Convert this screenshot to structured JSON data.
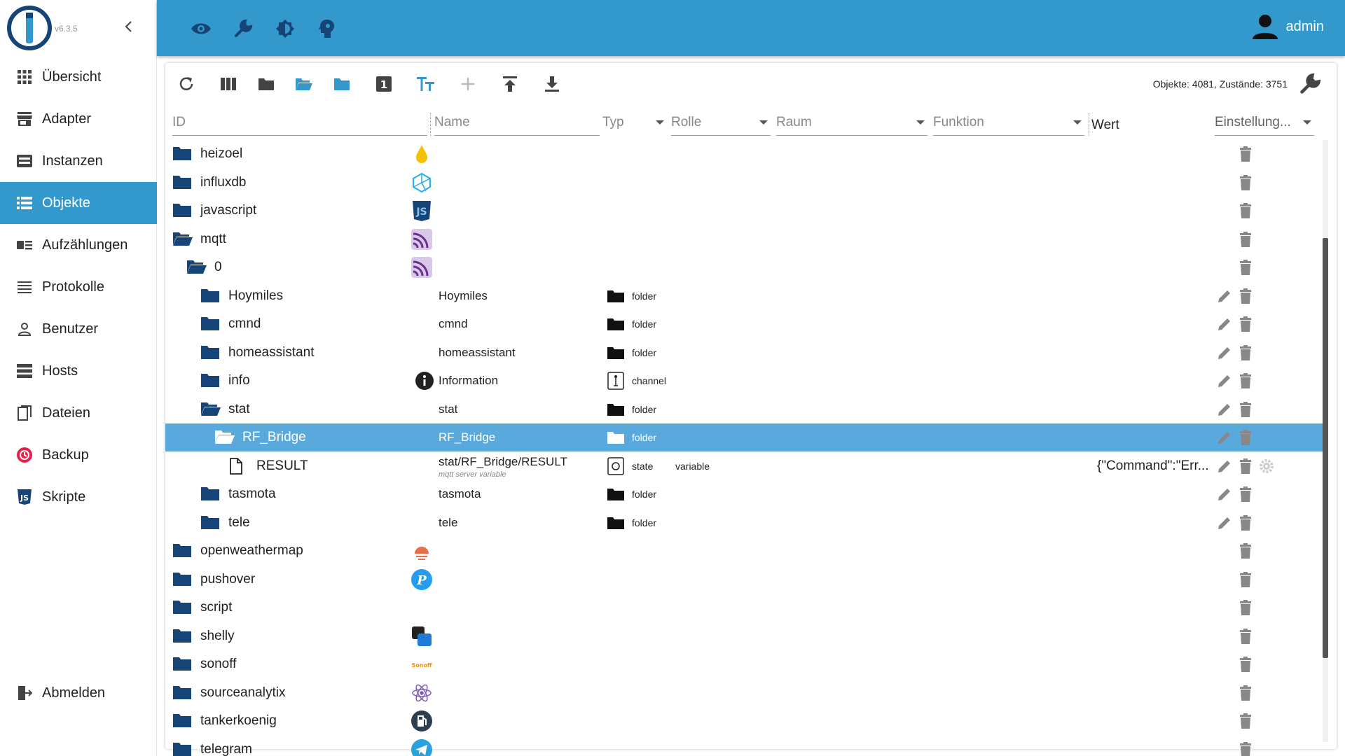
{
  "sidebar": {
    "version": "v6.3.5",
    "items": [
      {
        "label": "Übersicht",
        "icon": "grid-icon"
      },
      {
        "label": "Adapter",
        "icon": "store-icon"
      },
      {
        "label": "Instanzen",
        "icon": "instances-icon"
      },
      {
        "label": "Objekte",
        "icon": "list-icon",
        "active": true
      },
      {
        "label": "Aufzählungen",
        "icon": "enum-icon"
      },
      {
        "label": "Protokolle",
        "icon": "lines-icon"
      },
      {
        "label": "Benutzer",
        "icon": "person-icon"
      },
      {
        "label": "Hosts",
        "icon": "hosts-icon"
      },
      {
        "label": "Dateien",
        "icon": "files-icon"
      },
      {
        "label": "Backup",
        "icon": "backup-icon"
      },
      {
        "label": "Skripte",
        "icon": "js-icon"
      }
    ],
    "logout": "Abmelden"
  },
  "header": {
    "user": "admin",
    "icons": [
      "eye-icon",
      "wrench-icon",
      "brightness-icon",
      "head-icon"
    ]
  },
  "toolbar": {
    "stats": "Objekte: 4081, Zustände: 3751"
  },
  "columns": {
    "id": "ID",
    "name": "Name",
    "type": "Typ",
    "role": "Rolle",
    "room": "Raum",
    "function": "Funktion",
    "value": "Wert",
    "settings": "Einstellung..."
  },
  "rows": [
    {
      "id": "heizoel",
      "depth": 0,
      "folder": "closed",
      "adapter_icon": "drop-icon"
    },
    {
      "id": "influxdb",
      "depth": 0,
      "folder": "closed",
      "adapter_icon": "influx-icon"
    },
    {
      "id": "javascript",
      "depth": 0,
      "folder": "closed",
      "adapter_icon": "js-icon"
    },
    {
      "id": "mqtt",
      "depth": 0,
      "folder": "open",
      "adapter_icon": "mqtt-icon"
    },
    {
      "id": "0",
      "depth": 1,
      "folder": "open",
      "adapter_icon": "mqtt-icon"
    },
    {
      "id": "Hoymiles",
      "depth": 2,
      "folder": "closed",
      "name": "Hoymiles",
      "type": "folder",
      "editable": true
    },
    {
      "id": "cmnd",
      "depth": 2,
      "folder": "closed",
      "name": "cmnd",
      "type": "folder",
      "editable": true
    },
    {
      "id": "homeassistant",
      "depth": 2,
      "folder": "closed",
      "name": "homeassistant",
      "type": "folder",
      "editable": true
    },
    {
      "id": "info",
      "depth": 2,
      "folder": "closed",
      "name": "Information",
      "type": "channel",
      "name_icon": "info-icon",
      "editable": true
    },
    {
      "id": "stat",
      "depth": 2,
      "folder": "open",
      "name": "stat",
      "type": "folder",
      "editable": true
    },
    {
      "id": "RF_Bridge",
      "depth": 3,
      "folder": "open",
      "name": "RF_Bridge",
      "type": "folder",
      "editable": true,
      "selected": true
    },
    {
      "id": "RESULT",
      "depth": 4,
      "folder": "file",
      "name": "stat/RF_Bridge/RESULT",
      "subname": "mqtt server variable",
      "type": "state",
      "role": "variable",
      "value": "{\"Command\":\"Err...",
      "editable": true,
      "gear": true
    },
    {
      "id": "tasmota",
      "depth": 2,
      "folder": "closed",
      "name": "tasmota",
      "type": "folder",
      "editable": true
    },
    {
      "id": "tele",
      "depth": 2,
      "folder": "closed",
      "name": "tele",
      "type": "folder",
      "editable": true
    },
    {
      "id": "openweathermap",
      "depth": 0,
      "folder": "closed",
      "adapter_icon": "weather-icon"
    },
    {
      "id": "pushover",
      "depth": 0,
      "folder": "closed",
      "adapter_icon": "pushover-icon"
    },
    {
      "id": "script",
      "depth": 0,
      "folder": "closed"
    },
    {
      "id": "shelly",
      "depth": 0,
      "folder": "closed",
      "adapter_icon": "shelly-icon"
    },
    {
      "id": "sonoff",
      "depth": 0,
      "folder": "closed",
      "adapter_icon": "sonoff-icon",
      "adapter_text": "Sonoff"
    },
    {
      "id": "sourceanalytix",
      "depth": 0,
      "folder": "closed",
      "adapter_icon": "atom-icon"
    },
    {
      "id": "tankerkoenig",
      "depth": 0,
      "folder": "closed",
      "adapter_icon": "fuel-icon"
    },
    {
      "id": "telegram",
      "depth": 0,
      "folder": "closed",
      "adapter_icon": "telegram-icon"
    }
  ],
  "colors": {
    "accent": "#3399cc",
    "selected": "#5aa9dc",
    "folder": "#164477"
  }
}
